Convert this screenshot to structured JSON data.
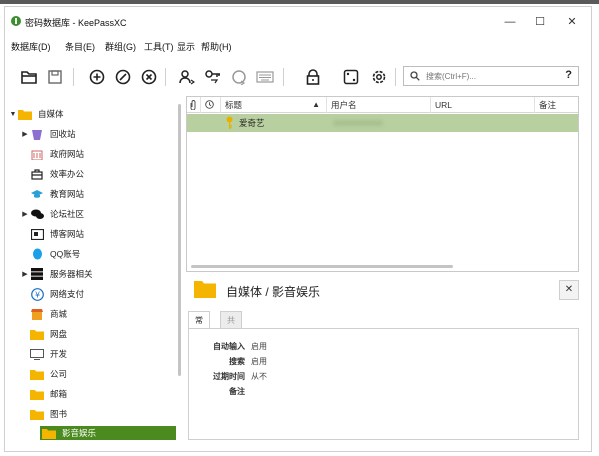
{
  "window": {
    "title": "密码数据库 - KeePassXC",
    "minimize_glyph": "—",
    "maximize_glyph": "☐",
    "close_glyph": "✕"
  },
  "menu": [
    "数据库(D)",
    "条目(E)",
    "群组(G)",
    "工具(T)",
    "显示",
    "帮助(H)"
  ],
  "toolbar": {
    "buttons": [
      "open-database-icon",
      "save-database-icon",
      "add-entry-icon",
      "edit-entry-icon",
      "delete-entry-icon",
      "copy-username-icon",
      "copy-password-icon",
      "copy-url-icon",
      "autotype-icon",
      "lock-database-icon",
      "password-generator-icon",
      "settings-icon"
    ],
    "search_placeholder": "搜索(Ctrl+F)...",
    "help_label": "?"
  },
  "sidebar": {
    "items": [
      {
        "label": "自媒体",
        "icon": "folder-icon",
        "arrow": "▼"
      },
      {
        "label": "回收站",
        "icon": "recycle-bin-icon",
        "arrow": "▶"
      },
      {
        "label": "政府网站",
        "icon": "building-icon",
        "arrow": ""
      },
      {
        "label": "效率办公",
        "icon": "briefcase-icon",
        "arrow": ""
      },
      {
        "label": "教育网站",
        "icon": "education-icon",
        "arrow": ""
      },
      {
        "label": "论坛社区",
        "icon": "chat-icon",
        "arrow": "▶"
      },
      {
        "label": "博客网站",
        "icon": "blog-icon",
        "arrow": ""
      },
      {
        "label": "QQ账号",
        "icon": "qq-icon",
        "arrow": ""
      },
      {
        "label": "服务器相关",
        "icon": "server-icon",
        "arrow": "▶"
      },
      {
        "label": "网络支付",
        "icon": "yen-icon",
        "arrow": ""
      },
      {
        "label": "商城",
        "icon": "shop-icon",
        "arrow": ""
      },
      {
        "label": "网盘",
        "icon": "folder-icon",
        "arrow": ""
      },
      {
        "label": "开发",
        "icon": "monitor-icon",
        "arrow": ""
      },
      {
        "label": "公司",
        "icon": "folder-icon",
        "arrow": ""
      },
      {
        "label": "邮箱",
        "icon": "folder-icon",
        "arrow": ""
      },
      {
        "label": "图书",
        "icon": "folder-icon",
        "arrow": ""
      },
      {
        "label": "影音娱乐",
        "icon": "folder-icon",
        "arrow": ""
      }
    ],
    "selected_index": 16
  },
  "table": {
    "headers": [
      "",
      "",
      "标题",
      "用户名",
      "URL",
      "备注"
    ],
    "sort_indicator": "▲",
    "rows": [
      {
        "title": "爱奇艺",
        "icon": "key-icon",
        "username": "",
        "url": "",
        "notes": ""
      }
    ]
  },
  "details": {
    "path": "自媒体 / 影音娱乐",
    "close_label": "✕",
    "tabs": [
      "常规",
      "共享"
    ],
    "fields": [
      {
        "label": "自动输入",
        "value": "启用"
      },
      {
        "label": "搜索",
        "value": "启用"
      },
      {
        "label": "过期时间",
        "value": "从不"
      },
      {
        "label": "备注",
        "value": ""
      }
    ]
  },
  "colors": {
    "selected_group": "#4a8a1e",
    "selected_row": "#b8cf9f",
    "folder": "#f4b400"
  }
}
